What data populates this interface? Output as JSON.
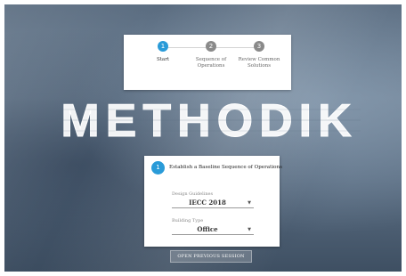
{
  "stepper": {
    "steps": [
      {
        "number": "1",
        "label": "Start",
        "active": true,
        "color": "#2a9bd8"
      },
      {
        "number": "2",
        "label": "Sequence of\nOperations",
        "active": false,
        "color": "#8a8a8a"
      },
      {
        "number": "3",
        "label": "Review Common\nSolutions",
        "active": false,
        "color": "#8a8a8a"
      }
    ]
  },
  "logo": {
    "text": "METHODIK"
  },
  "card": {
    "number": "1",
    "title": "Establish a Baseline Sequence of Operations",
    "accent": "#2a9bd8",
    "design_guidelines": {
      "label": "Design Guidelines",
      "value": "IECC 2018"
    },
    "building_type": {
      "label": "Building Type",
      "value": "Office"
    }
  },
  "session_button": {
    "label": "OPEN PREVIOUS SESSION"
  }
}
